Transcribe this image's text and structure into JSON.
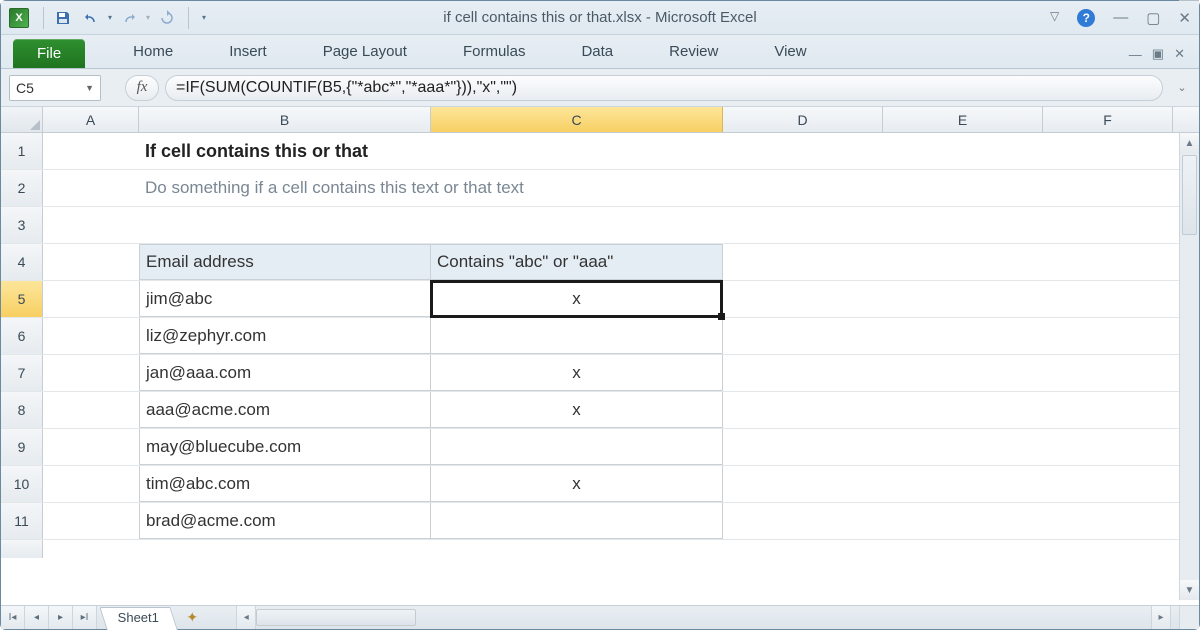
{
  "title": "if cell contains this or that.xlsx  -  Microsoft Excel",
  "ribbon": {
    "file": "File",
    "tabs": [
      "Home",
      "Insert",
      "Page Layout",
      "Formulas",
      "Data",
      "Review",
      "View"
    ]
  },
  "namebox": "C5",
  "fx_label": "fx",
  "formula": "=IF(SUM(COUNTIF(B5,{\"*abc*\",\"*aaa*\"})),\"x\",\"\")",
  "columns": [
    "A",
    "B",
    "C",
    "D",
    "E",
    "F"
  ],
  "selected_column": "C",
  "selected_row": 5,
  "content": {
    "b1": "If cell contains this or that",
    "b2": "Do something if a cell contains this text or that text",
    "headers": {
      "b4": "Email address",
      "c4": "Contains \"abc\" or \"aaa\""
    },
    "rows": [
      {
        "email": "jim@abc",
        "result": "x"
      },
      {
        "email": "liz@zephyr.com",
        "result": ""
      },
      {
        "email": "jan@aaa.com",
        "result": "x"
      },
      {
        "email": "aaa@acme.com",
        "result": "x"
      },
      {
        "email": "may@bluecube.com",
        "result": ""
      },
      {
        "email": "tim@abc.com",
        "result": "x"
      },
      {
        "email": "brad@acme.com",
        "result": ""
      }
    ]
  },
  "sheet_tab": "Sheet1"
}
